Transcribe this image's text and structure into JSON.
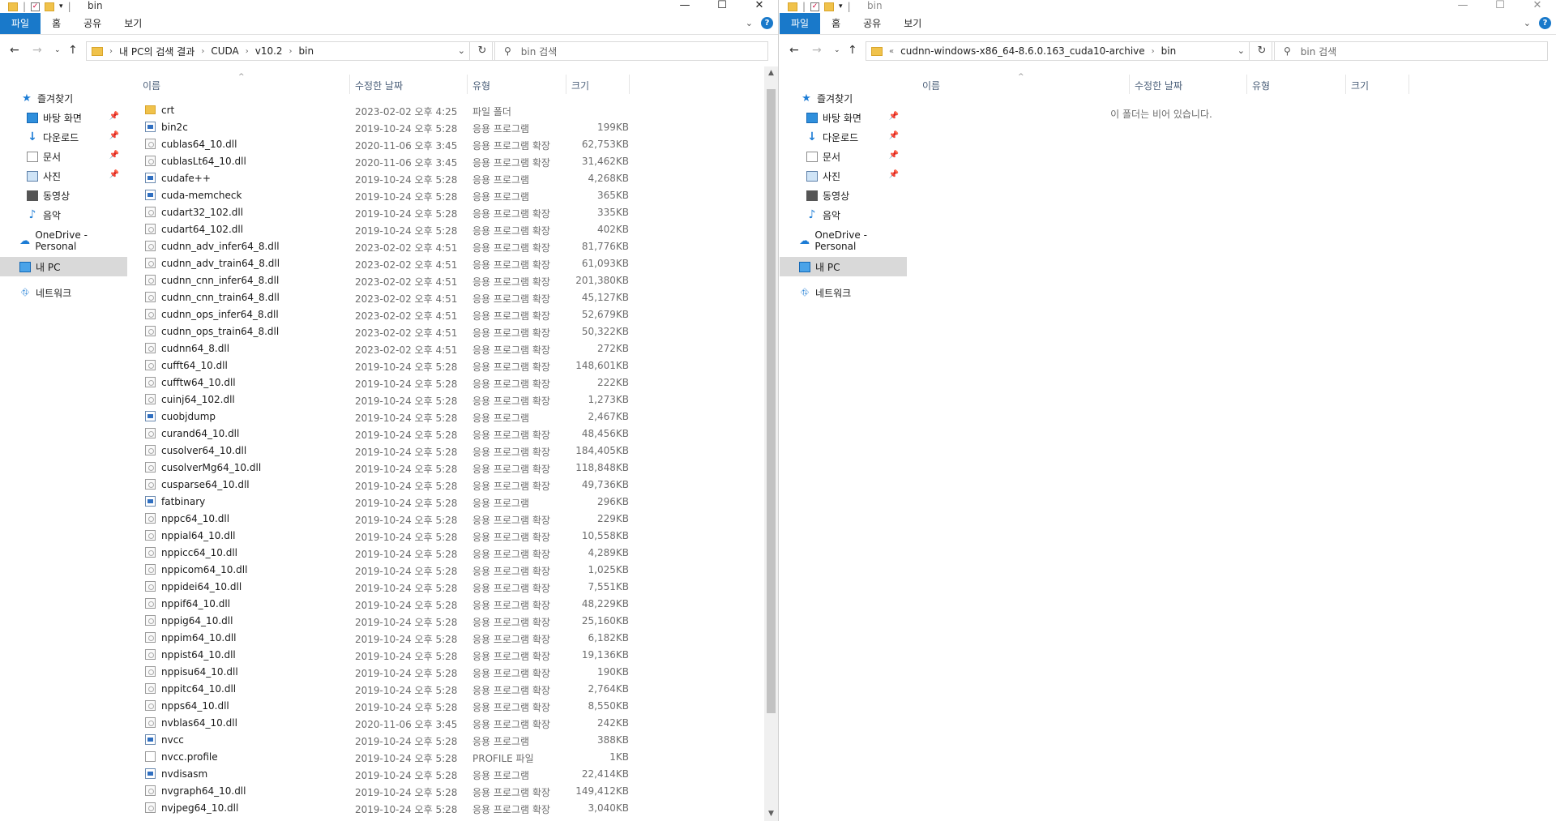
{
  "ribbon": {
    "file": "파일",
    "home": "홈",
    "share": "공유",
    "view": "보기"
  },
  "nav_pane": {
    "quick_access": "즐겨찾기",
    "pinned": [
      {
        "label": "바탕 화면",
        "icon": "desktop-icon"
      },
      {
        "label": "다운로드",
        "icon": "download-icon"
      },
      {
        "label": "문서",
        "icon": "documents-icon"
      },
      {
        "label": "사진",
        "icon": "pictures-icon"
      }
    ],
    "unpinned": [
      {
        "label": "동영상",
        "icon": "videos-icon"
      },
      {
        "label": "음악",
        "icon": "music-icon"
      }
    ],
    "onedrive": "OneDrive - Personal",
    "this_pc": "내 PC",
    "network": "네트워크"
  },
  "columns": {
    "name": "이름",
    "date": "수정한 날짜",
    "type": "유형",
    "size": "크기"
  },
  "left": {
    "title": "bin",
    "breadcrumb": [
      "내 PC의 검색 결과",
      "CUDA",
      "v10.2",
      "bin"
    ],
    "search_placeholder": "bin 검색",
    "files": [
      {
        "icon": "folder",
        "name": "crt",
        "date": "2023-02-02 오후 4:25",
        "type": "파일 폴더",
        "size": ""
      },
      {
        "icon": "exe",
        "name": "bin2c",
        "date": "2019-10-24 오후 5:28",
        "type": "응용 프로그램",
        "size": "199KB"
      },
      {
        "icon": "dll",
        "name": "cublas64_10.dll",
        "date": "2020-11-06 오후 3:45",
        "type": "응용 프로그램 확장",
        "size": "62,753KB"
      },
      {
        "icon": "dll",
        "name": "cublasLt64_10.dll",
        "date": "2020-11-06 오후 3:45",
        "type": "응용 프로그램 확장",
        "size": "31,462KB"
      },
      {
        "icon": "exe",
        "name": "cudafe++",
        "date": "2019-10-24 오후 5:28",
        "type": "응용 프로그램",
        "size": "4,268KB"
      },
      {
        "icon": "exe",
        "name": "cuda-memcheck",
        "date": "2019-10-24 오후 5:28",
        "type": "응용 프로그램",
        "size": "365KB"
      },
      {
        "icon": "dll",
        "name": "cudart32_102.dll",
        "date": "2019-10-24 오후 5:28",
        "type": "응용 프로그램 확장",
        "size": "335KB"
      },
      {
        "icon": "dll",
        "name": "cudart64_102.dll",
        "date": "2019-10-24 오후 5:28",
        "type": "응용 프로그램 확장",
        "size": "402KB"
      },
      {
        "icon": "dll",
        "name": "cudnn_adv_infer64_8.dll",
        "date": "2023-02-02 오후 4:51",
        "type": "응용 프로그램 확장",
        "size": "81,776KB"
      },
      {
        "icon": "dll",
        "name": "cudnn_adv_train64_8.dll",
        "date": "2023-02-02 오후 4:51",
        "type": "응용 프로그램 확장",
        "size": "61,093KB"
      },
      {
        "icon": "dll",
        "name": "cudnn_cnn_infer64_8.dll",
        "date": "2023-02-02 오후 4:51",
        "type": "응용 프로그램 확장",
        "size": "201,380KB"
      },
      {
        "icon": "dll",
        "name": "cudnn_cnn_train64_8.dll",
        "date": "2023-02-02 오후 4:51",
        "type": "응용 프로그램 확장",
        "size": "45,127KB"
      },
      {
        "icon": "dll",
        "name": "cudnn_ops_infer64_8.dll",
        "date": "2023-02-02 오후 4:51",
        "type": "응용 프로그램 확장",
        "size": "52,679KB"
      },
      {
        "icon": "dll",
        "name": "cudnn_ops_train64_8.dll",
        "date": "2023-02-02 오후 4:51",
        "type": "응용 프로그램 확장",
        "size": "50,322KB"
      },
      {
        "icon": "dll",
        "name": "cudnn64_8.dll",
        "date": "2023-02-02 오후 4:51",
        "type": "응용 프로그램 확장",
        "size": "272KB"
      },
      {
        "icon": "dll",
        "name": "cufft64_10.dll",
        "date": "2019-10-24 오후 5:28",
        "type": "응용 프로그램 확장",
        "size": "148,601KB"
      },
      {
        "icon": "dll",
        "name": "cufftw64_10.dll",
        "date": "2019-10-24 오후 5:28",
        "type": "응용 프로그램 확장",
        "size": "222KB"
      },
      {
        "icon": "dll",
        "name": "cuinj64_102.dll",
        "date": "2019-10-24 오후 5:28",
        "type": "응용 프로그램 확장",
        "size": "1,273KB"
      },
      {
        "icon": "exe",
        "name": "cuobjdump",
        "date": "2019-10-24 오후 5:28",
        "type": "응용 프로그램",
        "size": "2,467KB"
      },
      {
        "icon": "dll",
        "name": "curand64_10.dll",
        "date": "2019-10-24 오후 5:28",
        "type": "응용 프로그램 확장",
        "size": "48,456KB"
      },
      {
        "icon": "dll",
        "name": "cusolver64_10.dll",
        "date": "2019-10-24 오후 5:28",
        "type": "응용 프로그램 확장",
        "size": "184,405KB"
      },
      {
        "icon": "dll",
        "name": "cusolverMg64_10.dll",
        "date": "2019-10-24 오후 5:28",
        "type": "응용 프로그램 확장",
        "size": "118,848KB"
      },
      {
        "icon": "dll",
        "name": "cusparse64_10.dll",
        "date": "2019-10-24 오후 5:28",
        "type": "응용 프로그램 확장",
        "size": "49,736KB"
      },
      {
        "icon": "exe",
        "name": "fatbinary",
        "date": "2019-10-24 오후 5:28",
        "type": "응용 프로그램",
        "size": "296KB"
      },
      {
        "icon": "dll",
        "name": "nppc64_10.dll",
        "date": "2019-10-24 오후 5:28",
        "type": "응용 프로그램 확장",
        "size": "229KB"
      },
      {
        "icon": "dll",
        "name": "nppial64_10.dll",
        "date": "2019-10-24 오후 5:28",
        "type": "응용 프로그램 확장",
        "size": "10,558KB"
      },
      {
        "icon": "dll",
        "name": "nppicc64_10.dll",
        "date": "2019-10-24 오후 5:28",
        "type": "응용 프로그램 확장",
        "size": "4,289KB"
      },
      {
        "icon": "dll",
        "name": "nppicom64_10.dll",
        "date": "2019-10-24 오후 5:28",
        "type": "응용 프로그램 확장",
        "size": "1,025KB"
      },
      {
        "icon": "dll",
        "name": "nppidei64_10.dll",
        "date": "2019-10-24 오후 5:28",
        "type": "응용 프로그램 확장",
        "size": "7,551KB"
      },
      {
        "icon": "dll",
        "name": "nppif64_10.dll",
        "date": "2019-10-24 오후 5:28",
        "type": "응용 프로그램 확장",
        "size": "48,229KB"
      },
      {
        "icon": "dll",
        "name": "nppig64_10.dll",
        "date": "2019-10-24 오후 5:28",
        "type": "응용 프로그램 확장",
        "size": "25,160KB"
      },
      {
        "icon": "dll",
        "name": "nppim64_10.dll",
        "date": "2019-10-24 오후 5:28",
        "type": "응용 프로그램 확장",
        "size": "6,182KB"
      },
      {
        "icon": "dll",
        "name": "nppist64_10.dll",
        "date": "2019-10-24 오후 5:28",
        "type": "응용 프로그램 확장",
        "size": "19,136KB"
      },
      {
        "icon": "dll",
        "name": "nppisu64_10.dll",
        "date": "2019-10-24 오후 5:28",
        "type": "응용 프로그램 확장",
        "size": "190KB"
      },
      {
        "icon": "dll",
        "name": "nppitc64_10.dll",
        "date": "2019-10-24 오후 5:28",
        "type": "응용 프로그램 확장",
        "size": "2,764KB"
      },
      {
        "icon": "dll",
        "name": "npps64_10.dll",
        "date": "2019-10-24 오후 5:28",
        "type": "응용 프로그램 확장",
        "size": "8,550KB"
      },
      {
        "icon": "dll",
        "name": "nvblas64_10.dll",
        "date": "2020-11-06 오후 3:45",
        "type": "응용 프로그램 확장",
        "size": "242KB"
      },
      {
        "icon": "exe",
        "name": "nvcc",
        "date": "2019-10-24 오후 5:28",
        "type": "응용 프로그램",
        "size": "388KB"
      },
      {
        "icon": "prof",
        "name": "nvcc.profile",
        "date": "2019-10-24 오후 5:28",
        "type": "PROFILE 파일",
        "size": "1KB"
      },
      {
        "icon": "exe",
        "name": "nvdisasm",
        "date": "2019-10-24 오후 5:28",
        "type": "응용 프로그램",
        "size": "22,414KB"
      },
      {
        "icon": "dll",
        "name": "nvgraph64_10.dll",
        "date": "2019-10-24 오후 5:28",
        "type": "응용 프로그램 확장",
        "size": "149,412KB"
      },
      {
        "icon": "dll",
        "name": "nvjpeg64_10.dll",
        "date": "2019-10-24 오후 5:28",
        "type": "응용 프로그램 확장",
        "size": "3,040KB"
      }
    ]
  },
  "right": {
    "title": "bin",
    "breadcrumb": [
      "cudnn-windows-x86_64-8.6.0.163_cuda10-archive",
      "bin"
    ],
    "search_placeholder": "bin 검색",
    "empty_message": "이 폴더는 비어 있습니다."
  }
}
